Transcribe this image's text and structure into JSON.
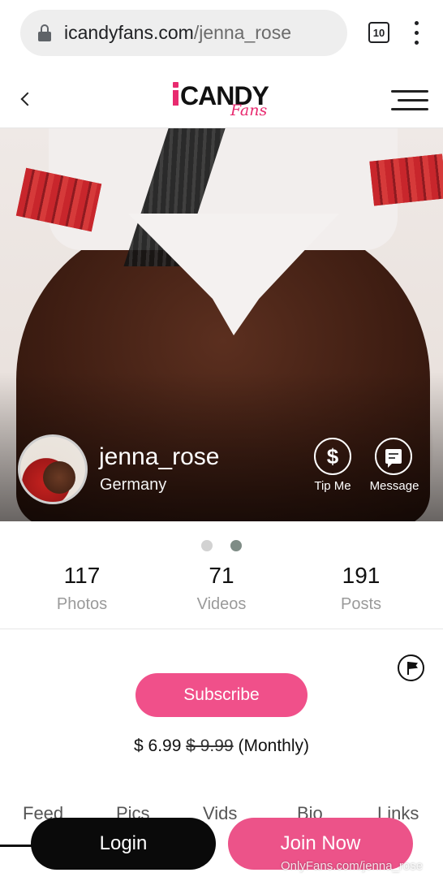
{
  "browser": {
    "url_domain": "icandyfans.com",
    "url_path": "/jenna_rose",
    "tab_count": "10"
  },
  "header": {
    "logo_main": "CANDY",
    "logo_sub": "Fans"
  },
  "profile": {
    "username": "jenna_rose",
    "country": "Germany",
    "tip_label": "Tip Me",
    "tip_symbol": "$",
    "message_label": "Message"
  },
  "carousel": {
    "active_index": 2,
    "count": 2
  },
  "stats": [
    {
      "value": "117",
      "label": "Photos"
    },
    {
      "value": "71",
      "label": "Videos"
    },
    {
      "value": "191",
      "label": "Posts"
    }
  ],
  "subscription": {
    "button_label": "Subscribe",
    "price_current": "$ 6.99",
    "price_original": "$ 9.99",
    "period": "(Monthly)"
  },
  "tabs": [
    "Feed",
    "Pics",
    "Vids",
    "Bio",
    "Links"
  ],
  "bottom_bar": {
    "login_label": "Login",
    "join_label": "Join Now"
  },
  "watermark": "OnlyFans.com/jenna_rose",
  "colors": {
    "brand_pink": "#f0508a",
    "dark": "#0a0a0a"
  },
  "icons": [
    "lock-icon",
    "tabs-counter-icon",
    "more-vert-icon",
    "back-chevron-icon",
    "menu-icon",
    "dollar-icon",
    "chat-icon",
    "flag-icon"
  ]
}
